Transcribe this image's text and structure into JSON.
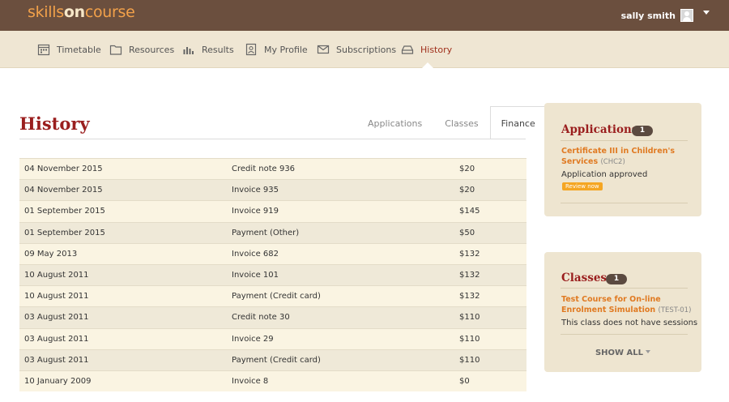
{
  "brand": {
    "part1": "skills",
    "part2": "on",
    "part3": "course"
  },
  "user": {
    "name": "sally smith"
  },
  "nav": {
    "items": [
      {
        "label": "Timetable",
        "icon": "calendar-icon"
      },
      {
        "label": "Resources",
        "icon": "folder-icon"
      },
      {
        "label": "Results",
        "icon": "bar-chart-icon"
      },
      {
        "label": "My Profile",
        "icon": "profile-icon"
      },
      {
        "label": "Subscriptions",
        "icon": "envelope-icon"
      },
      {
        "label": "History",
        "icon": "inbox-icon",
        "active": true
      }
    ]
  },
  "page": {
    "title": "History",
    "tabs": [
      {
        "label": "Applications"
      },
      {
        "label": "Classes"
      },
      {
        "label": "Finance",
        "active": true
      }
    ]
  },
  "finance": {
    "rows": [
      {
        "date": "04 November 2015",
        "description": "Credit note 936",
        "amount": "$20"
      },
      {
        "date": "04 November 2015",
        "description": "Invoice 935",
        "amount": "$20"
      },
      {
        "date": "01 September 2015",
        "description": "Invoice 919",
        "amount": "$145"
      },
      {
        "date": "01 September 2015",
        "description": "Payment (Other)",
        "amount": "$50"
      },
      {
        "date": "09 May 2013",
        "description": "Invoice 682",
        "amount": "$132"
      },
      {
        "date": "10 August 2011",
        "description": "Invoice 101",
        "amount": "$132"
      },
      {
        "date": "10 August 2011",
        "description": "Payment (Credit card)",
        "amount": "$132"
      },
      {
        "date": "03 August 2011",
        "description": "Credit note 30",
        "amount": "$110"
      },
      {
        "date": "03 August 2011",
        "description": "Invoice 29",
        "amount": "$110"
      },
      {
        "date": "03 August 2011",
        "description": "Payment (Credit card)",
        "amount": "$110"
      },
      {
        "date": "10 January 2009",
        "description": "Invoice 8",
        "amount": "$0"
      }
    ]
  },
  "applications_card": {
    "title": "Applications",
    "count": "1",
    "item": {
      "course_line1": "Certificate III in Children's",
      "course_line2": "Services",
      "code": "(CHC2)",
      "status": "Application approved",
      "action": "Review now"
    }
  },
  "classes_card": {
    "title": "Classes",
    "count": "1",
    "item": {
      "course_line1": "Test Course for On-line",
      "course_line2": "Enrolment Simulation",
      "code": "(TEST-01)",
      "status": "This class does not have sessions"
    },
    "show_all": "SHOW ALL"
  },
  "colors": {
    "topbar": "#6b4f3e",
    "nav_bg": "#efe6d3",
    "accent_red": "#9a1e1e",
    "link_orange": "#e07a22",
    "badge": "#5b4a40",
    "review_button": "#f5a623"
  }
}
